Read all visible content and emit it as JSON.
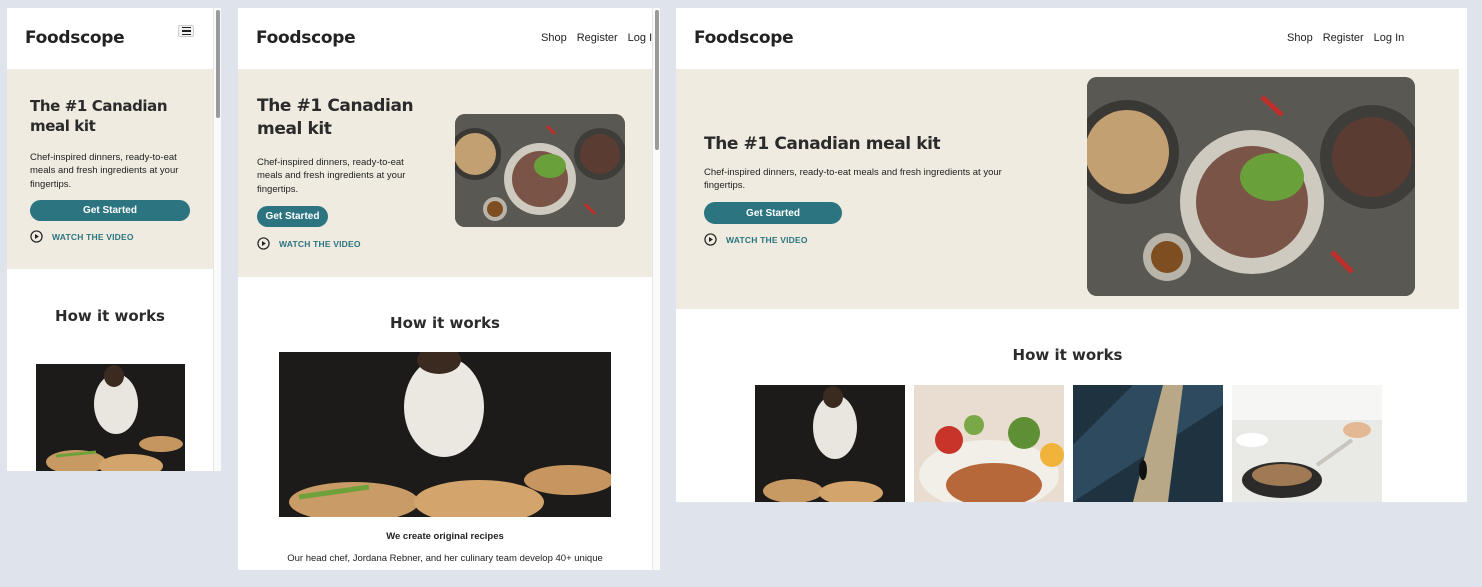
{
  "brand": {
    "name": "Foodscope",
    "accent": "#2c7480",
    "hero_bg": "#efebe0",
    "page_bg": "#dfe3ec"
  },
  "nav": {
    "shop": "Shop",
    "register": "Register",
    "login": "Log In"
  },
  "hero": {
    "title": "The #1 Canadian meal kit",
    "subtitle": "Chef-inspired dinners, ready-to-eat meals and fresh ingredients at your fingertips.",
    "cta": "Get Started",
    "video": "WATCH THE VIDEO"
  },
  "how": {
    "title": "How it works",
    "card1_title": "We create original recipes",
    "card1_text": "Our head chef, Jordana Rebner, and her culinary team develop 40+ unique"
  },
  "icons": {
    "menu": "hamburger-icon",
    "play": "play-circle-icon"
  }
}
